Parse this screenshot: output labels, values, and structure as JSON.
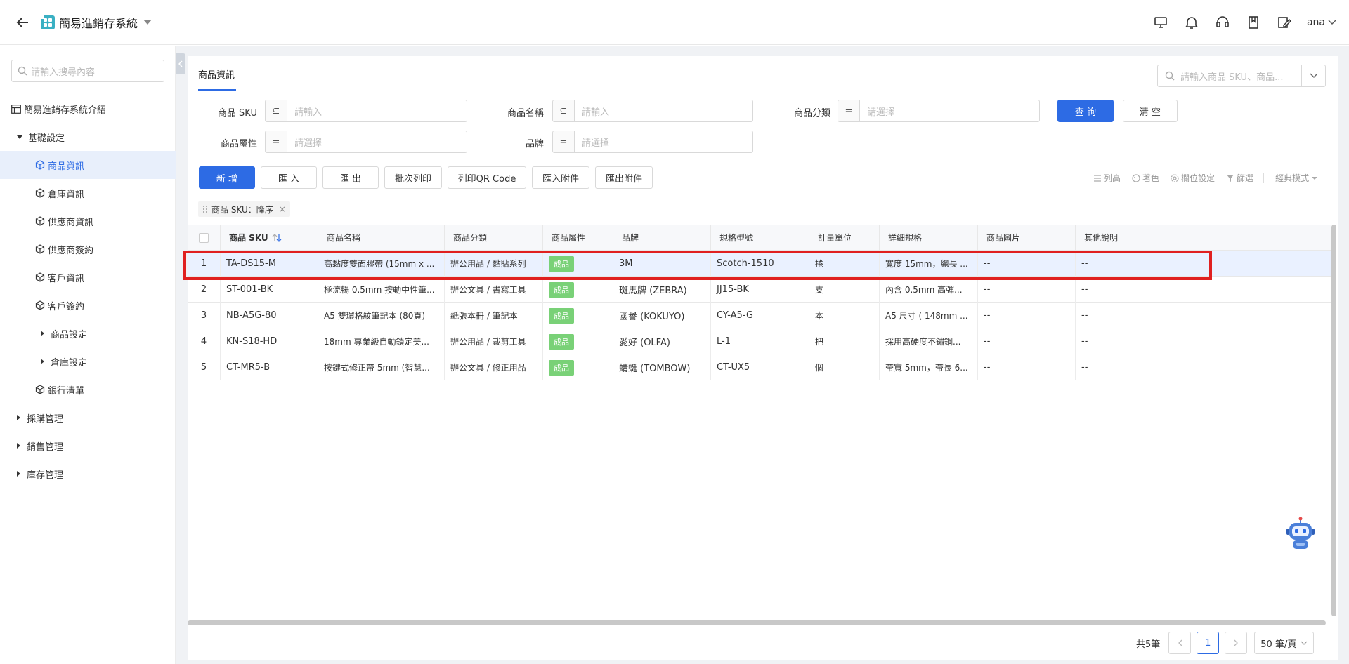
{
  "header": {
    "app_title": "簡易進銷存系統",
    "user_name": "ana"
  },
  "sidebar": {
    "search_placeholder": "請輸入搜尋內容",
    "items": [
      {
        "label": "簡易進銷存系統介紹"
      },
      {
        "label": "基礎設定"
      },
      {
        "label": "商品資訊"
      },
      {
        "label": "倉庫資訊"
      },
      {
        "label": "供應商資訊"
      },
      {
        "label": "供應商簽約"
      },
      {
        "label": "客戶資訊"
      },
      {
        "label": "客戶簽約"
      },
      {
        "label": "商品設定"
      },
      {
        "label": "倉庫設定"
      },
      {
        "label": "銀行清單"
      },
      {
        "label": "採購管理"
      },
      {
        "label": "銷售管理"
      },
      {
        "label": "庫存管理"
      }
    ]
  },
  "tab": {
    "label": "商品資訊",
    "search_placeholder": "請輸入商品 SKU、商品..."
  },
  "filters": {
    "sku_label": "商品 SKU",
    "name_label": "商品名稱",
    "category_label": "商品分類",
    "attr_label": "商品屬性",
    "brand_label": "品牌",
    "input_placeholder": "請輸入",
    "select_placeholder": "請選擇",
    "op_contains": "⊆",
    "op_equals": "="
  },
  "actions": {
    "query": "查 詢",
    "clear": "清 空",
    "add": "新 增",
    "import": "匯 入",
    "export": "匯 出",
    "batch_print": "批次列印",
    "print_qr": "列印QR Code",
    "import_attach": "匯入附件",
    "export_attach": "匯出附件"
  },
  "tools": {
    "row_height": "列高",
    "color": "著色",
    "column_settings": "欄位設定",
    "filter": "篩選",
    "mode": "經典模式"
  },
  "sort_chip": "商品 SKU：降序",
  "table": {
    "headers": [
      "商品 SKU",
      "商品名稱",
      "商品分類",
      "商品屬性",
      "品牌",
      "規格型號",
      "計量單位",
      "詳細規格",
      "商品圖片",
      "其他說明"
    ],
    "rows": [
      [
        "1",
        "TA-DS15-M",
        "高黏度雙面膠帶 (15mm x ...",
        "辦公用品 / 黏貼系列",
        "成品",
        "3M",
        "Scotch-1510",
        "捲",
        "寬度 15mm，總長 ...",
        "--",
        "--"
      ],
      [
        "2",
        "ST-001-BK",
        "極流暢 0.5mm 按動中性筆...",
        "辦公文具 / 書寫工具",
        "成品",
        "斑馬牌 (ZEBRA)",
        "JJ15-BK",
        "支",
        "內含 0.5mm 高彈...",
        "--",
        "--"
      ],
      [
        "3",
        "NB-A5G-80",
        "A5 雙環格紋筆記本 (80頁)",
        "紙張本冊 / 筆記本",
        "成品",
        "國譽 (KOKUYO)",
        "CY-A5-G",
        "本",
        "A5 尺寸 ( 148mm ...",
        "--",
        "--"
      ],
      [
        "4",
        "KN-S18-HD",
        "18mm 專業級自動鎖定美...",
        "辦公用品 / 裁剪工具",
        "成品",
        "愛好 (OLFA)",
        "L-1",
        "把",
        "採用高硬度不鏽鋼...",
        "--",
        "--"
      ],
      [
        "5",
        "CT-MR5-B",
        "按鍵式修正帶 5mm (智慧...",
        "辦公文具 / 修正用品",
        "成品",
        "蜻蜓 (TOMBOW)",
        "CT-UX5",
        "個",
        "帶寬 5mm，帶長 6...",
        "--",
        "--"
      ]
    ]
  },
  "pager": {
    "total": "共5筆",
    "current": "1",
    "page_size": "50 筆/頁"
  },
  "colors": {
    "accent": "#2d6be4",
    "tag_green": "#79d177",
    "highlight_red": "#e02020"
  }
}
